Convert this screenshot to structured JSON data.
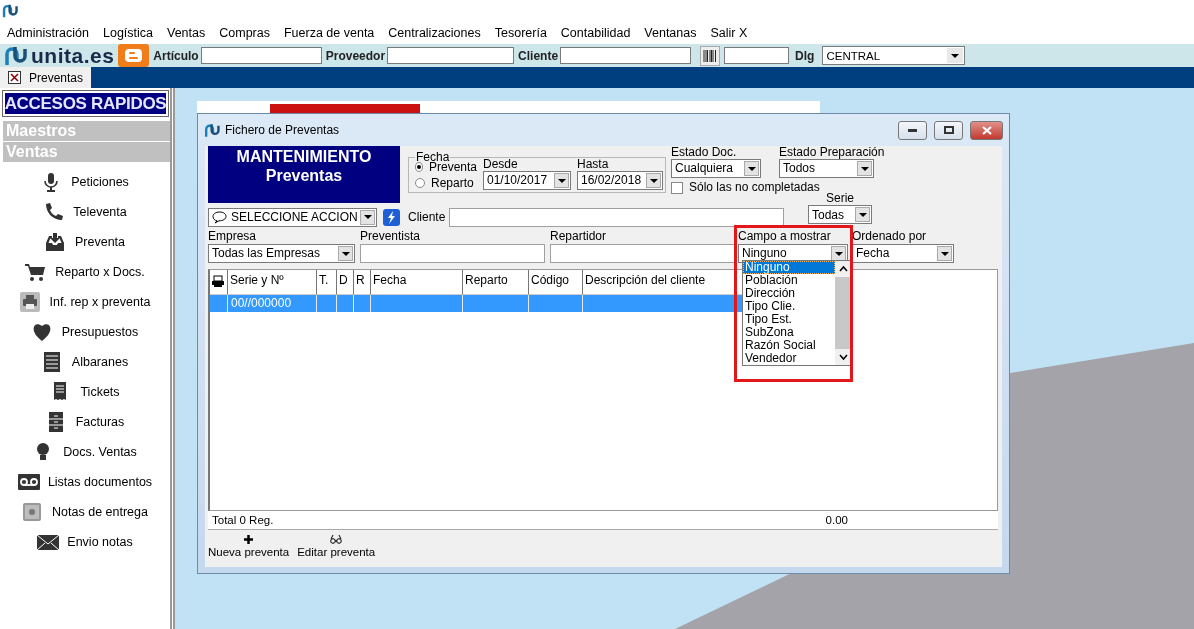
{
  "menu": [
    "Administración",
    "Logística",
    "Ventas",
    "Compras",
    "Fuerza de venta",
    "Centralizaciones",
    "Tesorería",
    "Contabilidad",
    "Ventanas",
    "Salir X"
  ],
  "toolbar": {
    "logo": "unita.es",
    "fields": [
      {
        "label": "Artículo"
      },
      {
        "label": "Proveedor"
      },
      {
        "label": "Cliente"
      }
    ],
    "dlg": {
      "label": "Dlg",
      "value": "CENTRAL"
    }
  },
  "tabs": [
    {
      "label": "Preventas",
      "selected": true
    }
  ],
  "sidebar": {
    "title": "ACCESOS RAPIDOS",
    "sections": [
      "Maestros",
      "Ventas"
    ],
    "items": [
      {
        "label": "Peticiones"
      },
      {
        "label": "Televenta"
      },
      {
        "label": "Preventa"
      },
      {
        "label": "Reparto x Docs."
      },
      {
        "label": "Inf. rep x preventa"
      },
      {
        "label": "Presupuestos"
      },
      {
        "label": "Albaranes"
      },
      {
        "label": "Tickets"
      },
      {
        "label": "Facturas"
      },
      {
        "label": "Docs. Ventas"
      },
      {
        "label": "Listas documentos"
      },
      {
        "label": "Notas de entrega"
      },
      {
        "label": "Envio notas"
      }
    ]
  },
  "window": {
    "title": "Fichero de Preventas",
    "banner": [
      "MANTENIMIENTO",
      "Preventas"
    ],
    "fecha": {
      "label": "Fecha",
      "radios": [
        {
          "label": "Preventa",
          "selected": true
        },
        {
          "label": "Reparto",
          "selected": false
        }
      ],
      "desde": {
        "label": "Desde",
        "value": "01/10/2017"
      },
      "hasta": {
        "label": "Hasta",
        "value": "16/02/2018"
      }
    },
    "estado_doc": {
      "label": "Estado Doc.",
      "value": "Cualquiera"
    },
    "only_incomplete": {
      "label": "Sólo las no completadas",
      "checked": false
    },
    "estado_preparacion": {
      "label": "Estado Preparación",
      "value": "Todos"
    },
    "serie": {
      "label": "Serie",
      "value": "Todas"
    },
    "action": {
      "value": "SELECCIONE ACCION"
    },
    "cliente": {
      "label": "Cliente"
    },
    "empresa": {
      "label": "Empresa",
      "value": "Todas las Empresas"
    },
    "preventista": {
      "label": "Preventista"
    },
    "repartidor": {
      "label": "Repartidor"
    },
    "campo_a_mostrar": {
      "label": "Campo a mostrar",
      "value": "Ninguno",
      "expanded": true,
      "options": [
        {
          "label": "Ninguno",
          "selected": true
        },
        {
          "label": "Población",
          "selected": false
        },
        {
          "label": "Dirección",
          "selected": false
        },
        {
          "label": "Tipo Clie.",
          "selected": false
        },
        {
          "label": "Tipo Est.",
          "selected": false
        },
        {
          "label": "SubZona",
          "selected": false
        },
        {
          "label": "Razón Social",
          "selected": false
        },
        {
          "label": "Vendedor",
          "selected": false
        }
      ]
    },
    "ordenado_por": {
      "label": "Ordenado por",
      "value": "Fecha"
    },
    "grid": {
      "columns": [
        "Serie y Nº",
        "T.",
        "D",
        "R",
        "Fecha",
        "Reparto",
        "Código",
        "Descripción del cliente"
      ],
      "rows": [
        {
          "serie_y_n": "00//000000",
          "selected": true
        }
      ]
    },
    "footer": {
      "total": "Total 0 Reg.",
      "amount": "0.00"
    },
    "actions": [
      {
        "label": "Nueva preventa"
      },
      {
        "label": "Editar preventa"
      }
    ]
  }
}
